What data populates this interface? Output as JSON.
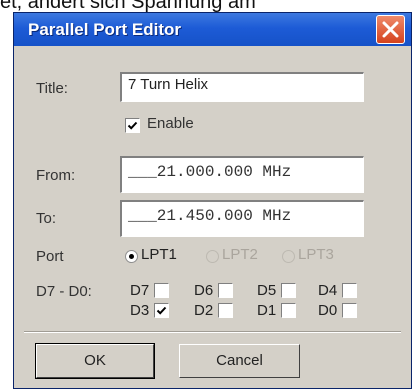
{
  "background": {
    "caption": "et, ändert sich Spannung am"
  },
  "window": {
    "title": "Parallel Port Editor"
  },
  "fields": {
    "title_label": "Title:",
    "title_value": "7 Turn Helix",
    "enable_label": "Enable",
    "enable_checked": true,
    "from_label": "From:",
    "from_value": "___21.000.000 MHz",
    "to_label": "To:",
    "to_value": "___21.450.000 MHz",
    "port_label": "Port",
    "ports": [
      {
        "label": "LPT1",
        "selected": true,
        "enabled": true
      },
      {
        "label": "LPT2",
        "selected": false,
        "enabled": false
      },
      {
        "label": "LPT3",
        "selected": false,
        "enabled": false
      }
    ],
    "bits_label": "D7 - D0:",
    "bits": [
      {
        "label": "D7",
        "checked": false
      },
      {
        "label": "D6",
        "checked": false
      },
      {
        "label": "D5",
        "checked": false
      },
      {
        "label": "D4",
        "checked": false
      },
      {
        "label": "D3",
        "checked": true
      },
      {
        "label": "D2",
        "checked": false
      },
      {
        "label": "D1",
        "checked": false
      },
      {
        "label": "D0",
        "checked": false
      }
    ]
  },
  "buttons": {
    "ok": "OK",
    "cancel": "Cancel"
  },
  "colors": {
    "titlebar": "#1d5bd6",
    "close": "#d4421e",
    "face": "#d4d0c8"
  }
}
